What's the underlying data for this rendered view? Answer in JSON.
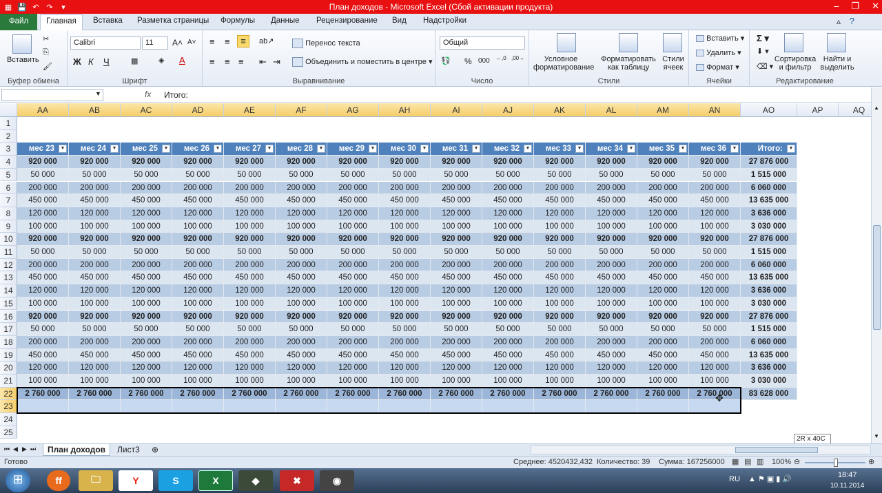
{
  "title": "План доходов  -  Microsoft Excel (Сбой активации продукта)",
  "tabs": [
    "Файл",
    "Главная",
    "Вставка",
    "Разметка страницы",
    "Формулы",
    "Данные",
    "Рецензирование",
    "Вид",
    "Надстройки"
  ],
  "ribbon": {
    "paste": "Вставить",
    "clipboard": "Буфер обмена",
    "font_name": "Calibri",
    "font_size": "11",
    "font_group": "Шрифт",
    "wrap_text": "Перенос текста",
    "merge_center": "Объединить и поместить в центре",
    "alignment_group": "Выравнивание",
    "number_format": "Общий",
    "number_group": "Число",
    "cond_format": "Условное форматирование",
    "format_table": "Форматировать как таблицу",
    "cell_styles": "Стили ячеек",
    "styles_group": "Стили",
    "insert": "Вставить",
    "delete": "Удалить",
    "format": "Формат",
    "cells_group": "Ячейки",
    "sort_filter": "Сортировка и фильтр",
    "find_select": "Найти и выделить",
    "editing_group": "Редактирование",
    "bold": "Ж",
    "italic": "К",
    "underline": "Ч"
  },
  "formula": {
    "name_box": "",
    "fx": "fx",
    "value": "Итого:"
  },
  "columns": [
    "AA",
    "AB",
    "AC",
    "AD",
    "AE",
    "AF",
    "AG",
    "AH",
    "AI",
    "AJ",
    "AK",
    "AL",
    "AM",
    "AN",
    "AO",
    "AP",
    "AQ"
  ],
  "rows": [
    "1",
    "2",
    "3",
    "4",
    "5",
    "6",
    "7",
    "8",
    "9",
    "10",
    "11",
    "12",
    "13",
    "14",
    "15",
    "16",
    "17",
    "18",
    "19",
    "20",
    "21",
    "22",
    "23",
    "24",
    "25"
  ],
  "table": {
    "headers": [
      "мес 23",
      "мес 24",
      "мес 25",
      "мес 26",
      "мес 27",
      "мес 28",
      "мес 29",
      "мес 30",
      "мес 31",
      "мес 32",
      "мес 33",
      "мес 34",
      "мес 35",
      "мес 36",
      "Итого:"
    ],
    "rows": [
      {
        "v": "920 000",
        "t": "27 876 000",
        "bold": true
      },
      {
        "v": "50 000",
        "t": "1 515 000",
        "bold": false
      },
      {
        "v": "200 000",
        "t": "6 060 000",
        "bold": false
      },
      {
        "v": "450 000",
        "t": "13 635 000",
        "bold": false
      },
      {
        "v": "120 000",
        "t": "3 636 000",
        "bold": false
      },
      {
        "v": "100 000",
        "t": "3 030 000",
        "bold": false
      },
      {
        "v": "920 000",
        "t": "27 876 000",
        "bold": true
      },
      {
        "v": "50 000",
        "t": "1 515 000",
        "bold": false
      },
      {
        "v": "200 000",
        "t": "6 060 000",
        "bold": false
      },
      {
        "v": "450 000",
        "t": "13 635 000",
        "bold": false
      },
      {
        "v": "120 000",
        "t": "3 636 000",
        "bold": false
      },
      {
        "v": "100 000",
        "t": "3 030 000",
        "bold": false
      },
      {
        "v": "920 000",
        "t": "27 876 000",
        "bold": true
      },
      {
        "v": "50 000",
        "t": "1 515 000",
        "bold": false
      },
      {
        "v": "200 000",
        "t": "6 060 000",
        "bold": false
      },
      {
        "v": "450 000",
        "t": "13 635 000",
        "bold": false
      },
      {
        "v": "120 000",
        "t": "3 636 000",
        "bold": false
      },
      {
        "v": "100 000",
        "t": "3 030 000",
        "bold": false
      }
    ],
    "total_row": {
      "v": "2 760 000",
      "t": "83 628 000"
    }
  },
  "tooltip": "2R x 40C",
  "sheets": [
    "План доходов",
    "Лист3"
  ],
  "status": {
    "ready": "Готово",
    "average": "Среднее: 4520432,432",
    "count": "Количество: 39",
    "sum": "Сумма: 167256000",
    "zoom": "100%"
  },
  "taskbar": {
    "lang": "RU",
    "time": "18:47",
    "date": "10.11.2014"
  }
}
